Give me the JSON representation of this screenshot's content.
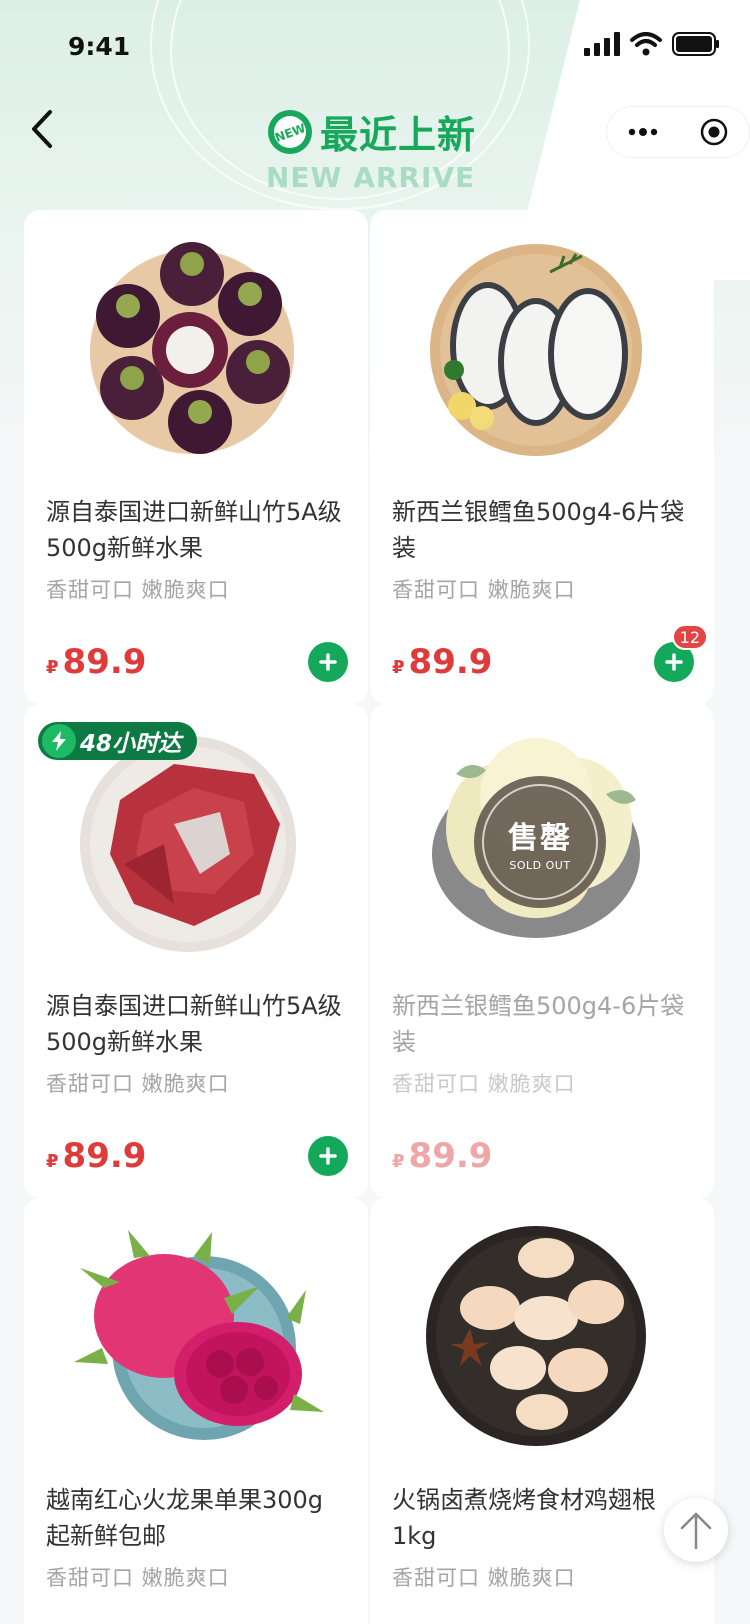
{
  "status_bar": {
    "time": "9:41"
  },
  "header": {
    "title_cn": "最近上新",
    "title_en": "NEW ARRIVE",
    "new_badge_text": "NEW",
    "back_icon": "chevron-left-icon",
    "capsule": {
      "more_icon": "more-dots-icon",
      "close_icon": "target-circle-icon"
    }
  },
  "colors": {
    "brand_green": "#14a85a",
    "price_red": "#e03b3b",
    "tag_green": "#0e7a43"
  },
  "products": [
    {
      "name": "源自泰国进口新鲜山竹5A级500g新鲜水果",
      "sub": "香甜可口 嫩脆爽口",
      "currency": "₽",
      "price": "89.9",
      "image": "mangosteen"
    },
    {
      "name": "新西兰银鳕鱼500g4-6片袋装",
      "sub": "香甜可口 嫩脆爽口",
      "currency": "₽",
      "price": "89.9",
      "cart_count": "12",
      "image": "cod-fish"
    },
    {
      "name": "源自泰国进口新鲜山竹5A级500g新鲜水果",
      "sub": "香甜可口 嫩脆爽口",
      "currency": "₽",
      "price": "89.9",
      "tag": "48小时达",
      "image": "beef"
    },
    {
      "name": "新西兰银鳕鱼500g4-6片袋装",
      "sub": "香甜可口 嫩脆爽口",
      "currency": "₽",
      "price": "89.9",
      "sold_out_cn": "售罄",
      "sold_out_en": "SOLD OUT",
      "image": "pomelo"
    },
    {
      "name": "越南红心火龙果单果300g起新鲜包邮",
      "sub": "香甜可口 嫩脆爽口",
      "image": "dragon-fruit"
    },
    {
      "name": "火锅卤煮烧烤食材鸡翅根1kg",
      "sub": "香甜可口 嫩脆爽口",
      "image": "chicken-drumsticks"
    }
  ],
  "back_to_top_icon": "arrow-up-icon"
}
